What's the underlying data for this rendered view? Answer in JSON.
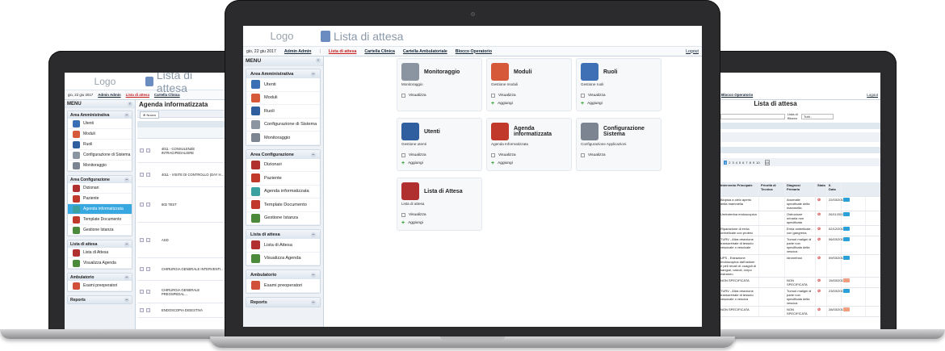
{
  "center": {
    "logo": "Logo",
    "page_title": "Lista di attesa",
    "date": "gio, 22 giu 2017",
    "user": "Admin Admin",
    "nav": [
      "Lista di attesa",
      "Cartella Clinica",
      "Cartella Ambulatoriale",
      "Blocco Operatorio"
    ],
    "logout": "Logout",
    "menu_label": "MENU",
    "groups": [
      {
        "title": "Area Amministrativa",
        "items": [
          "Utenti",
          "Moduli",
          "Ruoli",
          "Configurazione di Sistema",
          "Monitoraggio"
        ]
      },
      {
        "title": "Area Configurazione",
        "items": [
          "Dizionari",
          "Paziente",
          "Agenda informatizzata",
          "Template Documento",
          "Gestione Istanza"
        ]
      },
      {
        "title": "Lista di attesa",
        "items": [
          "Lista di Attesa",
          "Visualizza Agenda"
        ]
      },
      {
        "title": "Ambulatorio",
        "items": [
          "Esami preoperatori"
        ]
      },
      {
        "title": "Reports",
        "items": []
      }
    ],
    "tiles": [
      {
        "title": "Monitoraggio",
        "subtitle": "Monitoraggio",
        "actions": [
          "Visualizza"
        ],
        "color": "#8b95a1"
      },
      {
        "title": "Moduli",
        "subtitle": "Gestione moduli",
        "actions": [
          "Visualizza",
          "Aggiungi"
        ],
        "color": "#d65a3a"
      },
      {
        "title": "Ruoli",
        "subtitle": "Gestione ruoli",
        "actions": [
          "Visualizza",
          "Aggiungi"
        ],
        "color": "#3f6fb5"
      },
      {
        "title": "Utenti",
        "subtitle": "Gestione utenti",
        "actions": [
          "Visualizza",
          "Aggiungi"
        ],
        "color": "#2f5f9e"
      },
      {
        "title": "Agenda informatizzata",
        "subtitle": "Agenda Informatizzata",
        "actions": [
          "Visualizza",
          "Aggiungi"
        ],
        "color": "#c0392b"
      },
      {
        "title": "Configurazione Sistema",
        "subtitle": "Configurazione Applicazioni",
        "actions": [
          "Visualizza"
        ],
        "color": "#7b8490"
      },
      {
        "title": "Lista di Attesa",
        "subtitle": "Lista di attesa",
        "actions": [
          "Visualizza",
          "Aggiungi"
        ],
        "color": "#b03030"
      }
    ]
  },
  "left": {
    "logo": "Logo",
    "page_title": "Lista di attesa",
    "date": "gio, 22 giu 2017",
    "user": "Admin Admin",
    "nav": [
      "Lista di attesa",
      "Cartella Clinica"
    ],
    "menu_label": "MENU",
    "content_title": "Agenda informatizzata",
    "new_button": "Nuovo",
    "groups": [
      {
        "title": "Area Amministrativa",
        "items": [
          "Utenti",
          "Moduli",
          "Ruoli",
          "Configurazione di Sistema",
          "Monitoraggio"
        ]
      },
      {
        "title": "Area Configurazione",
        "items": [
          "Dizionari",
          "Paziente",
          "Agenda informatizzata",
          "Template Documento",
          "Gestione Istanza"
        ]
      },
      {
        "title": "Lista di attesa",
        "items": [
          "Lista di Attesa",
          "Visualizza Agenda"
        ]
      },
      {
        "title": "Ambulatorio",
        "items": [
          "Esami preoperatori"
        ]
      },
      {
        "title": "Reports",
        "items": []
      }
    ],
    "rows": [
      "4011 - CONSULENZE INTRACIPEDALIERE",
      "4011 - VISITE DI CONTROLLO (DAY H...",
      "602 TEST",
      "ASD",
      "CHIRURGIA GENERALE INTERVENTI...",
      "CHIRURGIA GENERALE PREOSPEDAL...",
      "ENDOSCOPIA DIGESTIVA"
    ]
  },
  "right": {
    "nav_item": "Blocco Operatorio",
    "logout": "Logout",
    "page_title": "Lista di attesa",
    "filter_label": "Lista di Blocco",
    "filter_value": "Tutti -",
    "pager": [
      "1",
      "2",
      "3",
      "4",
      "5",
      "6",
      "7",
      "8",
      "9",
      "10"
    ],
    "pager_total": "10",
    "columns": [
      "Intervento Principale",
      "Priorità di Tecnica",
      "Diagnosi Primaria",
      "Stato",
      "Il. Data"
    ],
    "rows": [
      {
        "intervento": "Biopsia a cielo aperto della mammella",
        "diagnosi": "Anomalie specificate della mammella",
        "data": "22/03/2011",
        "color": "#2aa0d8"
      },
      {
        "intervento": "Uretroterina endoscopica",
        "diagnosi": "Ostruzione urinaria non specificata",
        "data": "26/11/2011",
        "color": "#2aa0d8"
      },
      {
        "intervento": "Riparazione di ernia ombelicale con protesi",
        "diagnosi": "Ernia ombelicale, con gangrena",
        "data": "02/12/2011",
        "color": "#2aa0d8"
      },
      {
        "intervento": "TURV - Altra resezione transuretrale di tessuto vescicale o vescicale",
        "diagnosi": "Tumori maligni di parte non specificata della vescica",
        "data": "06/03/2012",
        "color": "#2aa0d8"
      },
      {
        "intervento": "UPS - Estrazione endoscopica dall'ostium e peli renali di: coaguli di sangue, calcoli, corpo estraneo",
        "diagnosi": "Idronefrosi",
        "data": "09/03/2012",
        "color": "#2aa0d8"
      },
      {
        "intervento": "NON SPECIFICATA",
        "diagnosi": "NON SPECIFICATA",
        "data": "15/03/2012",
        "color": "#f0a080"
      },
      {
        "intervento": "TURV - Altra resezione transuretrale di tessuto vescicale o vescica",
        "diagnosi": "Tumori maligni di parte non specificata della vescica",
        "data": "23/03/2012",
        "color": "#2aa0d8"
      },
      {
        "intervento": "NON SPECIFICATA",
        "diagnosi": "NON SPECIFICATA",
        "data": "28/03/2012",
        "color": "#f0a080"
      }
    ]
  }
}
